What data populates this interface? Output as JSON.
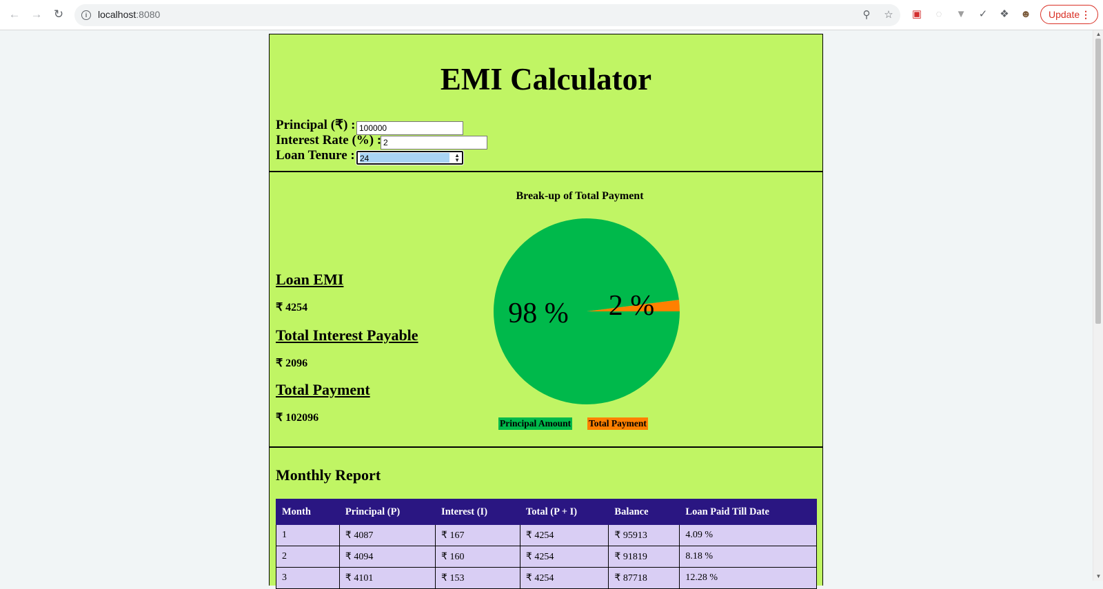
{
  "browser": {
    "url_host": "localhost",
    "url_port": ":8080",
    "update_label": "Update"
  },
  "app": {
    "title": "EMI Calculator",
    "fields": {
      "principal_label": "Principal (₹) :",
      "principal_value": "100000",
      "rate_label": "Interest Rate (%) :",
      "rate_value": "2",
      "tenure_label": "Loan Tenure :",
      "tenure_value": "24"
    }
  },
  "summary": {
    "emi_heading": "Loan EMI",
    "emi_value": "₹ 4254",
    "interest_heading": "Total Interest Payable",
    "interest_value": "₹ 2096",
    "total_heading": "Total Payment",
    "total_value": "₹ 102096"
  },
  "chart_data": {
    "type": "pie",
    "title": "Break-up of Total Payment",
    "slices": [
      {
        "label": "Principal Amount",
        "value": 98,
        "display": "98 %",
        "color": "#00b94b"
      },
      {
        "label": "Total Payment",
        "value": 2,
        "display": "2 %",
        "color": "#ff8000"
      }
    ]
  },
  "report": {
    "title": "Monthly Report",
    "columns": [
      "Month",
      "Principal (P)",
      "Interest (I)",
      "Total (P + I)",
      "Balance",
      "Loan Paid Till Date"
    ],
    "rows": [
      [
        "1",
        "₹ 4087",
        "₹ 167",
        "₹ 4254",
        "₹ 95913",
        "4.09 %"
      ],
      [
        "2",
        "₹ 4094",
        "₹ 160",
        "₹ 4254",
        "₹ 91819",
        "8.18 %"
      ],
      [
        "3",
        "₹ 4101",
        "₹ 153",
        "₹ 4254",
        "₹ 87718",
        "12.28 %"
      ]
    ]
  },
  "colors": {
    "app_background": "#c0f564",
    "table_header": "#2a1682",
    "table_cell": "#d9cef4",
    "principal_slice": "#00b94b",
    "interest_slice": "#ff8000"
  }
}
